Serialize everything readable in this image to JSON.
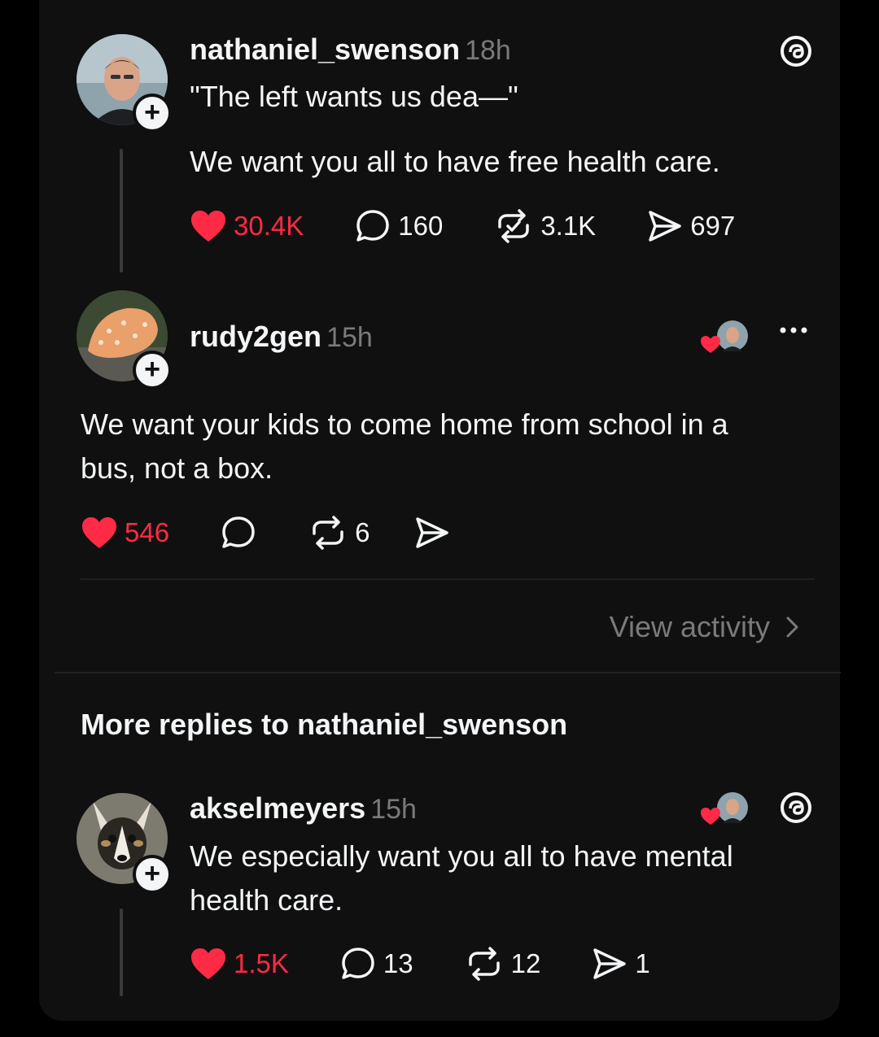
{
  "post": {
    "username": "nathaniel_swenson",
    "time": "18h",
    "line1": "\"The left wants us dea—\"",
    "line2": "We want you all to have free health care.",
    "likes": "30.4K",
    "comments": "160",
    "reposts": "3.1K",
    "shares": "697"
  },
  "reply": {
    "username": "rudy2gen",
    "time": "15h",
    "text_line1": "We want your kids to come home from school in a",
    "text_line2": "bus, not a box.",
    "likes": "546",
    "reposts": "6",
    "view_activity": "View activity"
  },
  "section_title": "More replies to nathaniel_swenson",
  "reply2": {
    "username": "akselmeyers",
    "time": "15h",
    "text_line1": "We especially want you all to have mental",
    "text_line2": "health care.",
    "likes": "1.5K",
    "comments": "13",
    "reposts": "12",
    "shares": "1"
  },
  "colors": {
    "background": "#101010",
    "like_red": "#ff2a45",
    "muted": "#7a7a7a"
  },
  "icons": [
    "threads-icon",
    "heart-icon",
    "comment-icon",
    "repost-icon",
    "share-icon",
    "more-icon",
    "chevron-right-icon",
    "follow-plus-icon"
  ]
}
